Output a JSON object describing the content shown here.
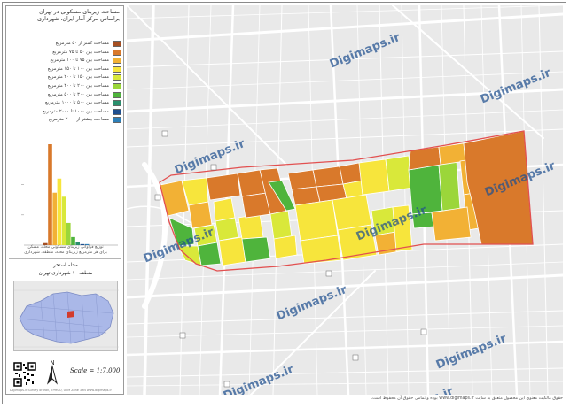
{
  "legend": {
    "title": "مساحت زیربنای مسکونی در تهران\nبراساس مرکز آمار ایران، شهرداری",
    "classes": [
      {
        "label": "مساحت کمتر از ۵۰ مترمربع",
        "color": "#a64f22"
      },
      {
        "label": "مساحت بین ۵۰ تا ۷۵ مترمربع",
        "color": "#d9792b"
      },
      {
        "label": "مساحت بین ۷۵ تا ۱۰۰ مترمربع",
        "color": "#f2b135"
      },
      {
        "label": "مساحت بین ۱۰۰ تا ۱۵۰ مترمربع",
        "color": "#f7e53c"
      },
      {
        "label": "مساحت بین ۱۵۰ تا ۲۰۰ مترمربع",
        "color": "#d9e83a"
      },
      {
        "label": "مساحت بین ۲۰۰ تا ۳۰۰ مترمربع",
        "color": "#9bd63a"
      },
      {
        "label": "مساحت بین ۳۰۰ تا ۵۰۰ مترمربع",
        "color": "#4fb43c"
      },
      {
        "label": "مساحت بین ۵۰۰ تا ۱۰۰۰ مترمربع",
        "color": "#2a8f6d"
      },
      {
        "label": "مساحت بین ۱۰۰۰ تا ۲۰۰۰ مترمربع",
        "color": "#1f4f8f"
      },
      {
        "label": "مساحت بیشتر از ۲۰۰۰ مترمربع",
        "color": "#2d7fb8"
      }
    ]
  },
  "histogram": {
    "bars": [
      {
        "value": 2,
        "color": "#a64f22"
      },
      {
        "value": 100,
        "color": "#d9792b"
      },
      {
        "value": 52,
        "color": "#f2b135"
      },
      {
        "value": 66,
        "color": "#f7e53c"
      },
      {
        "value": 48,
        "color": "#d9e83a"
      },
      {
        "value": 22,
        "color": "#9bd63a"
      },
      {
        "value": 8,
        "color": "#4fb43c"
      },
      {
        "value": 3,
        "color": "#2a8f6d"
      },
      {
        "value": 1,
        "color": "#1f4f8f"
      },
      {
        "value": 1,
        "color": "#2d7fb8"
      }
    ],
    "ylim": [
      0,
      100
    ],
    "caption": "توزیع فراوانی زیربنای مسکونی محله، مسکن\nبرای هر مترمربع زیربنای محله، منطقه، شهرداری"
  },
  "location": {
    "title": "محله استخر\nمنطقه ۱۰ شهرداری تهران"
  },
  "scale": "Scale = 1:7,000",
  "north_icon": "north-arrow-icon",
  "watermark": "Digimaps.ir",
  "panel_footer": "Digimaps.ir    Survey of Iran, TPMCO, UTM Zone 39N   www.digimaps.ir",
  "footer": "حقوق مالکیت معنوی این محصول متعلق به سایت www.digimaps.ir بوده و تمامی حقوق آن محفوظ است."
}
